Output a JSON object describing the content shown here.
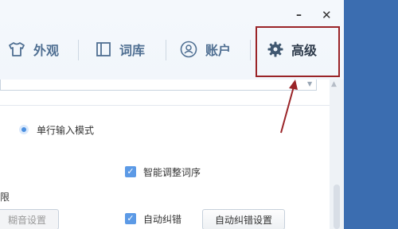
{
  "window": {
    "minimize_label": "–",
    "close_label": "✕"
  },
  "tabs": [
    {
      "label": "外观",
      "icon": "tshirt-icon",
      "active": false
    },
    {
      "label": "词库",
      "icon": "book-icon",
      "active": false
    },
    {
      "label": "账户",
      "icon": "user-icon",
      "active": false
    },
    {
      "label": "高级",
      "icon": "gear-icon",
      "active": true
    }
  ],
  "annotation": {
    "color": "#9a2428"
  },
  "content": {
    "radio_single_line": "单行输入模式",
    "partial_left_text": "限",
    "checkbox_smart_order": "智能调整词序",
    "checkbox_autocorrect": "自动纠错",
    "button_fuzzy": "糊音设置",
    "button_autocorrect": "自动纠错设置"
  },
  "colors": {
    "accent": "#4a8fe0",
    "checkbox": "#5c9ae6",
    "background_right": "#3b6db0"
  }
}
